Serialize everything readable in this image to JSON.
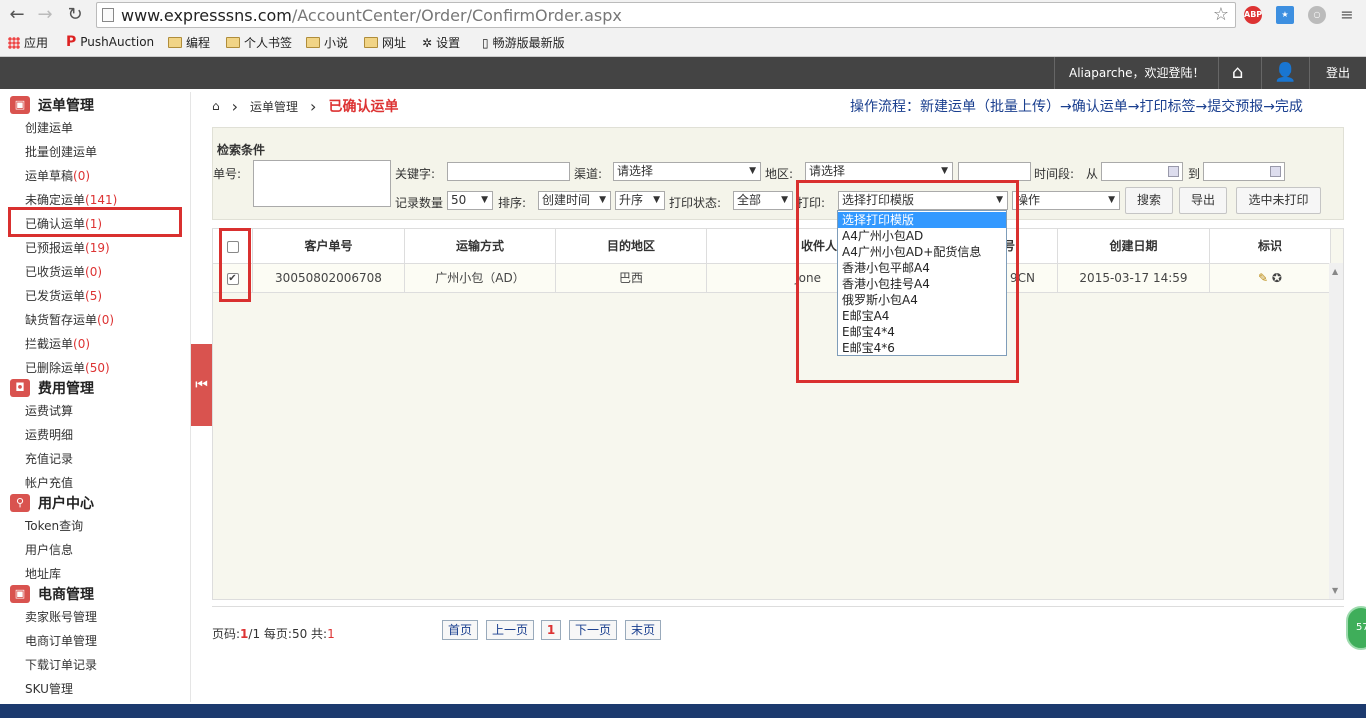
{
  "browser": {
    "url_host": "www.expresssns.com",
    "url_path": "/AccountCenter/Order/ConfirmOrder.aspx",
    "ext_abp": "ABP",
    "bookmarks": [
      "应用",
      "PushAuction",
      "编程",
      "个人书签",
      "小说",
      "网址",
      "设置",
      "畅游版最新版"
    ]
  },
  "topbar": {
    "greeting": "Aliaparche，欢迎登陆！",
    "logout": "登出"
  },
  "sidebar": {
    "sections": [
      {
        "title": "运单管理",
        "items": [
          {
            "label": "创建运单",
            "count": ""
          },
          {
            "label": "批量创建运单",
            "count": ""
          },
          {
            "label": "运单草稿",
            "count": "(0)"
          },
          {
            "label": "未确定运单",
            "count": "(141)"
          },
          {
            "label": "已确认运单",
            "count": "(1)"
          },
          {
            "label": "已预报运单",
            "count": "(19)"
          },
          {
            "label": "已收货运单",
            "count": "(0)"
          },
          {
            "label": "已发货运单",
            "count": "(5)"
          },
          {
            "label": "缺货暂存运单",
            "count": "(0)"
          },
          {
            "label": "拦截运单",
            "count": "(0)"
          },
          {
            "label": "已删除运单",
            "count": "(50)"
          }
        ]
      },
      {
        "title": "费用管理",
        "items": [
          {
            "label": "运费试算",
            "count": ""
          },
          {
            "label": "运费明细",
            "count": ""
          },
          {
            "label": "充值记录",
            "count": ""
          },
          {
            "label": "帐户充值",
            "count": ""
          }
        ]
      },
      {
        "title": "用户中心",
        "items": [
          {
            "label": "Token查询",
            "count": ""
          },
          {
            "label": "用户信息",
            "count": ""
          },
          {
            "label": "地址库",
            "count": ""
          }
        ]
      },
      {
        "title": "电商管理",
        "items": [
          {
            "label": "卖家账号管理",
            "count": ""
          },
          {
            "label": "电商订单管理",
            "count": ""
          },
          {
            "label": "下载订单记录",
            "count": ""
          },
          {
            "label": "SKU管理",
            "count": ""
          }
        ]
      }
    ]
  },
  "breadcrumb": {
    "section": "运单管理",
    "current": "已确认运单"
  },
  "flow_text": "操作流程：新建运单（批量上传）→确认运单→打印标签→提交预报→完成",
  "search": {
    "title": "检索条件",
    "order_no_label": "单号:",
    "keyword_label": "关键字:",
    "channel_label": "渠道:",
    "channel_value": "请选择",
    "region_label": "地区:",
    "region_value": "请选择",
    "period_label": "时间段:",
    "from_label": "从",
    "to_label": "到",
    "count_label": "记录数量",
    "count_value": "50",
    "sort_label": "排序:",
    "sort_value": "创建时间",
    "order_value": "升序",
    "print_status_label": "打印状态:",
    "print_status_value": "全部",
    "print_label": "打印:",
    "print_value": "选择打印模版",
    "action_value": "操作",
    "search_btn": "搜索",
    "export_btn": "导出",
    "unprinted_btn": "选中未打印"
  },
  "print_options": [
    "选择打印模版",
    "A4广州小包AD",
    "A4广州小包AD+配货信息",
    "香港小包平邮A4",
    "香港小包挂号A4",
    "俄罗斯小包A4",
    "E邮宝A4",
    "E邮宝4*4",
    "E邮宝4*6"
  ],
  "table": {
    "headers": [
      "客户单号",
      "运输方式",
      "目的地区",
      "收件人",
      "号",
      "创建日期",
      "标识"
    ],
    "row": {
      "customer_no": "30050802006708",
      "shipping": "广州小包（AD）",
      "destination": "巴西",
      "recipient": "Jone",
      "tracking": "9CN",
      "created": "2015-03-17 14:59"
    }
  },
  "pager": {
    "page_label": "页码:",
    "page": "1",
    "of": "/1 每页:50 共:",
    "total": "1",
    "first": "首页",
    "prev": "上一页",
    "current": "1",
    "next": "下一页",
    "last": "末页"
  },
  "bubble_text": "57"
}
